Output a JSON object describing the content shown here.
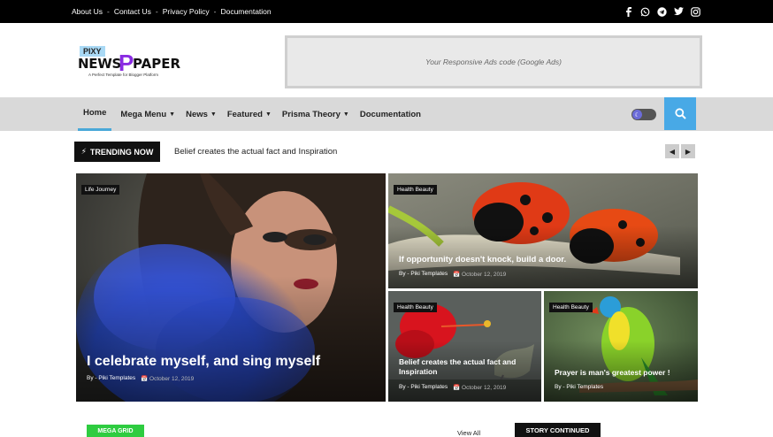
{
  "topbar": {
    "links": [
      "About Us",
      "Contact Us",
      "Privacy Policy",
      "Documentation"
    ],
    "separator": "-",
    "social_icons": [
      "facebook-icon",
      "whatsapp-icon",
      "telegram-icon",
      "twitter-icon",
      "instagram-icon"
    ]
  },
  "logo": {
    "badge": "PIXY",
    "news": "NEWS",
    "p": "P",
    "paper": "PAPER",
    "tagline": "A Perfect Template for Blogger Platform"
  },
  "ad": {
    "text": "Your Responsive Ads code (Google Ads)"
  },
  "nav": {
    "items": [
      {
        "label": "Home",
        "active": true,
        "dropdown": false
      },
      {
        "label": "Mega Menu",
        "dropdown": true
      },
      {
        "label": "News",
        "dropdown": true
      },
      {
        "label": "Featured",
        "dropdown": true
      },
      {
        "label": "Prisma Theory",
        "dropdown": true
      },
      {
        "label": "Documentation",
        "dropdown": false
      }
    ],
    "accent": "#48a9e6"
  },
  "trending": {
    "label": "TRENDING NOW",
    "headline": "Belief creates the actual fact and Inspiration"
  },
  "cards": [
    {
      "category": "Life Journey",
      "title": "I celebrate myself, and sing myself",
      "author": "By - Piki Templates",
      "date": "October 12, 2019"
    },
    {
      "category": "Health Beauty",
      "title": "If opportunity doesn't knock, build a door.",
      "author": "By - Piki Templates",
      "date": "October 12, 2019"
    },
    {
      "category": "Health Beauty",
      "title": "Belief creates the actual fact and Inspiration",
      "author": "By - Piki Templates",
      "date": "October 12, 2019"
    },
    {
      "category": "Health Beauty",
      "title": "Prayer is man's greatest power !",
      "author": "By - Piki Templates",
      "date": ""
    }
  ],
  "sections": {
    "mega_grid": "MEGA GRID",
    "view_all": "View All",
    "story_continued": "STORY CONTINUED"
  }
}
